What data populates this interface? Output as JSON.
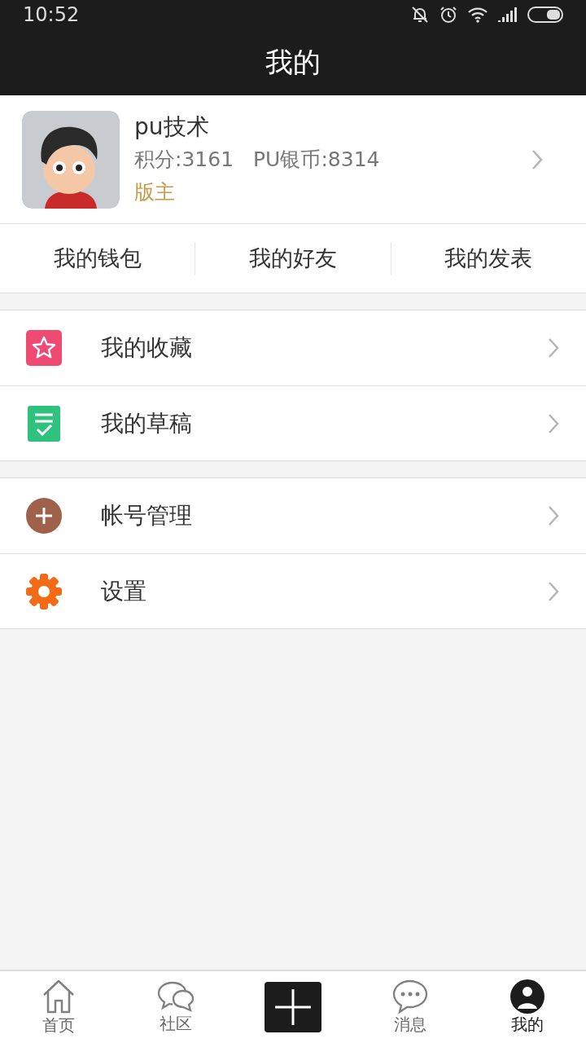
{
  "status_bar": {
    "time": "10:52"
  },
  "header": {
    "title": "我的"
  },
  "profile": {
    "name": "pu技术",
    "points": "积分:3161",
    "coins": "PU银币:8314",
    "role": "版主"
  },
  "shortcuts": [
    "我的钱包",
    "我的好友",
    "我的发表"
  ],
  "menu_groups": [
    [
      {
        "kind": "favorites",
        "label": "我的收藏"
      },
      {
        "kind": "drafts",
        "label": "我的草稿"
      }
    ],
    [
      {
        "kind": "account",
        "label": "帐号管理"
      },
      {
        "kind": "settings",
        "label": "设置"
      }
    ]
  ],
  "tab_bar": [
    {
      "kind": "home",
      "label": "首页",
      "selected": false
    },
    {
      "kind": "community",
      "label": "社区",
      "selected": false
    },
    {
      "kind": "post"
    },
    {
      "kind": "messages",
      "label": "消息",
      "selected": false
    },
    {
      "kind": "me",
      "label": "我的",
      "selected": true
    }
  ]
}
